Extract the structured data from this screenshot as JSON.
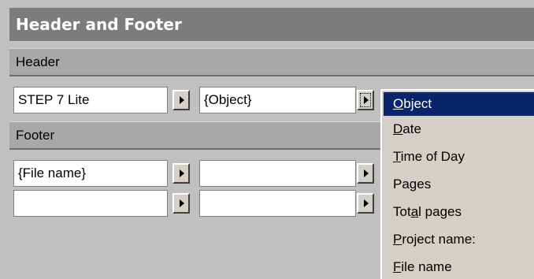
{
  "dialog": {
    "title": "Header and Footer"
  },
  "header_section": {
    "label": "Header",
    "fields": [
      {
        "value": "STEP 7 Lite"
      },
      {
        "value": "{Object}"
      }
    ]
  },
  "footer_section": {
    "label": "Footer",
    "row1": [
      {
        "value": "{File name}"
      },
      {
        "value": ""
      }
    ],
    "row2": [
      {
        "value": ""
      },
      {
        "value": ""
      }
    ]
  },
  "context_menu": {
    "items": [
      {
        "pre": "",
        "mnemonic": "O",
        "post": "bject",
        "selected": true
      },
      {
        "pre": "",
        "mnemonic": "D",
        "post": "ate",
        "selected": false
      },
      {
        "pre": "",
        "mnemonic": "T",
        "post": "ime of Day",
        "selected": false
      },
      {
        "pre": "Pa",
        "mnemonic": "g",
        "post": "es",
        "selected": false
      },
      {
        "pre": "Tot",
        "mnemonic": "a",
        "post": "l pages",
        "selected": false
      },
      {
        "pre": "",
        "mnemonic": "P",
        "post": "roject name:",
        "selected": false
      },
      {
        "pre": "",
        "mnemonic": "F",
        "post": "ile name",
        "selected": false
      }
    ]
  },
  "icons": {
    "arrow": "right-triangle-arrow-icon"
  },
  "colors": {
    "title_bar": "#7c7c7c",
    "section_bar": "#a8a8a8",
    "menu_highlight": "#0a246a",
    "dialog_bg": "#c0c0c0"
  }
}
